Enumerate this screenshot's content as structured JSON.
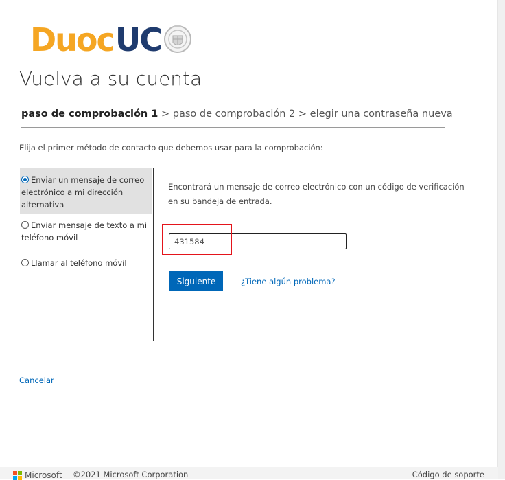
{
  "brand": {
    "name_part1": "Duoc",
    "name_part2": "UC",
    "logo_colors": {
      "duoc": "#f5a623",
      "uc": "#1f3b6e"
    }
  },
  "page": {
    "title": "Vuelva a su cuenta"
  },
  "steps": {
    "step1": "paso de comprobación 1",
    "sep1": " > ",
    "step2": "paso de comprobación 2",
    "sep2": " > ",
    "step3": "elegir una contraseña nueva"
  },
  "intro": "Elija el primer método de contacto que debemos usar para la comprobación:",
  "options": [
    {
      "label": "Enviar un mensaje de correo electrónico a mi dirección alternativa",
      "selected": true
    },
    {
      "label": "Enviar mensaje de texto a mi teléfono móvil",
      "selected": false
    },
    {
      "label": "Llamar al teléfono móvil",
      "selected": false
    }
  ],
  "panel": {
    "text": "Encontrará un mensaje de correo electrónico con un código de verificación en su bandeja de entrada.",
    "code_value": "431584",
    "next_label": "Siguiente",
    "help_label": "¿Tiene algún problema?"
  },
  "cancel_label": "Cancelar",
  "footer": {
    "ms_name": "Microsoft",
    "copyright": "©2021 Microsoft Corporation",
    "support": "Código de soporte"
  },
  "colors": {
    "accent": "#0067b8",
    "highlight": "#e4141b"
  }
}
